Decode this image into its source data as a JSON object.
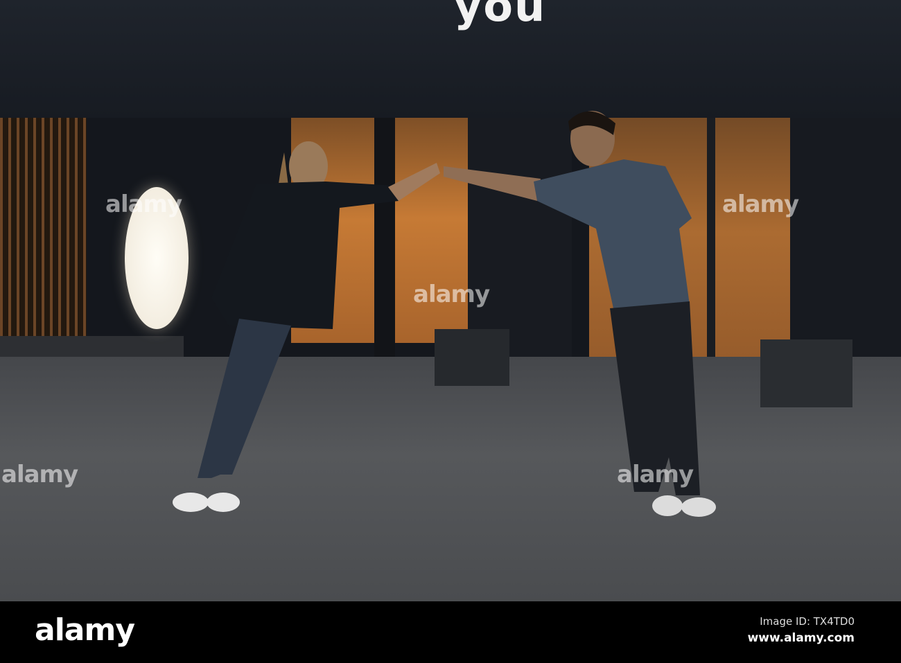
{
  "photo": {
    "sign_text": "you",
    "watermark": "alamy",
    "colors": {
      "window_glow": "#c67a35",
      "ground": "#56585b",
      "building": "#14171d"
    }
  },
  "footer": {
    "logo": "alamy",
    "image_id": "Image ID: TX4TD0",
    "website": "www.alamy.com"
  }
}
